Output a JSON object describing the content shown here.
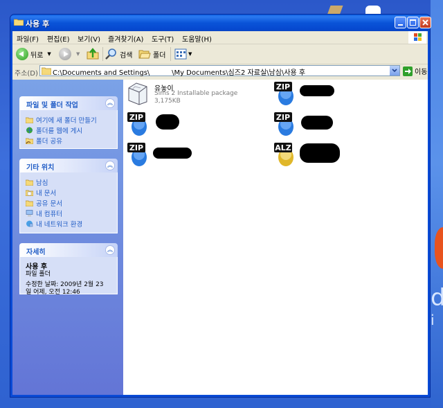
{
  "window": {
    "title": "사용 후"
  },
  "menu": [
    "파일(F)",
    "편집(E)",
    "보기(V)",
    "즐겨찾기(A)",
    "도구(T)",
    "도움말(H)"
  ],
  "toolbar": {
    "back_label": "뒤로",
    "search_label": "검색",
    "folders_label": "폴더"
  },
  "address": {
    "label": "주소(D)",
    "value": "C:\\Documents and Settings\\          \\My Documents\\심즈2 자료실\\남심\\사용 후",
    "go_label": "이동"
  },
  "sidebar": {
    "tasks": {
      "title": "파일 및 폴더 작업",
      "items": [
        "여기에 새 폴더 만들기",
        "폴더를 웹에 게시",
        "폴더 공유"
      ]
    },
    "places": {
      "title": "기타 위치",
      "items": [
        "남심",
        "내 문서",
        "공유 문서",
        "내 컴퓨터",
        "내 네트워크 환경"
      ]
    },
    "details": {
      "title": "자세히",
      "name": "사용 후",
      "type": "파일 폴더",
      "modified_line1": "수정한 날짜: 2009년 2월 23",
      "modified_line2": "일 어제, 오전 12:46"
    }
  },
  "files": [
    {
      "name": "유놓이",
      "type": "Sims 2 Installable package",
      "size": "3,175KB",
      "icon": "sims-package-icon"
    },
    {
      "name": "",
      "icon": "zip-icon"
    },
    {
      "name": "",
      "icon": "zip-icon"
    },
    {
      "name": "",
      "icon": "zip-icon"
    },
    {
      "name": "",
      "icon": "zip-icon"
    },
    {
      "name": "",
      "icon": "alz-icon"
    }
  ],
  "icon_labels": {
    "zip": "ZIP",
    "alz": "ALZ"
  },
  "colors": {
    "titlebar": "#0a54d8",
    "sidebar": "#7ba2e7",
    "link": "#215dc6"
  }
}
